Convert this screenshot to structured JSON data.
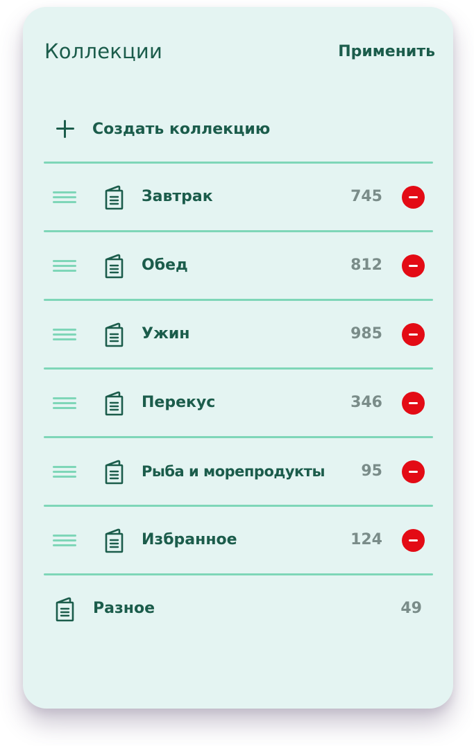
{
  "header": {
    "title": "Коллекции",
    "apply_label": "Применить"
  },
  "create": {
    "label": "Создать коллекцию",
    "icon": "plus-icon"
  },
  "colors": {
    "background": "#e4f4f2",
    "text": "#1b5c4b",
    "divider": "#7ed6b8",
    "count": "#7a8c89",
    "remove": "#e30b15"
  },
  "collections": [
    {
      "name": "Завтрак",
      "count": "745",
      "removable": true
    },
    {
      "name": "Обед",
      "count": "812",
      "removable": true
    },
    {
      "name": "Ужин",
      "count": "985",
      "removable": true
    },
    {
      "name": "Перекус",
      "count": "346",
      "removable": true
    },
    {
      "name": "Рыба и морепродукты",
      "count": "95",
      "removable": true
    },
    {
      "name": "Избранное",
      "count": "124",
      "removable": true
    }
  ],
  "static_collection": {
    "name": "Разное",
    "count": "49"
  }
}
